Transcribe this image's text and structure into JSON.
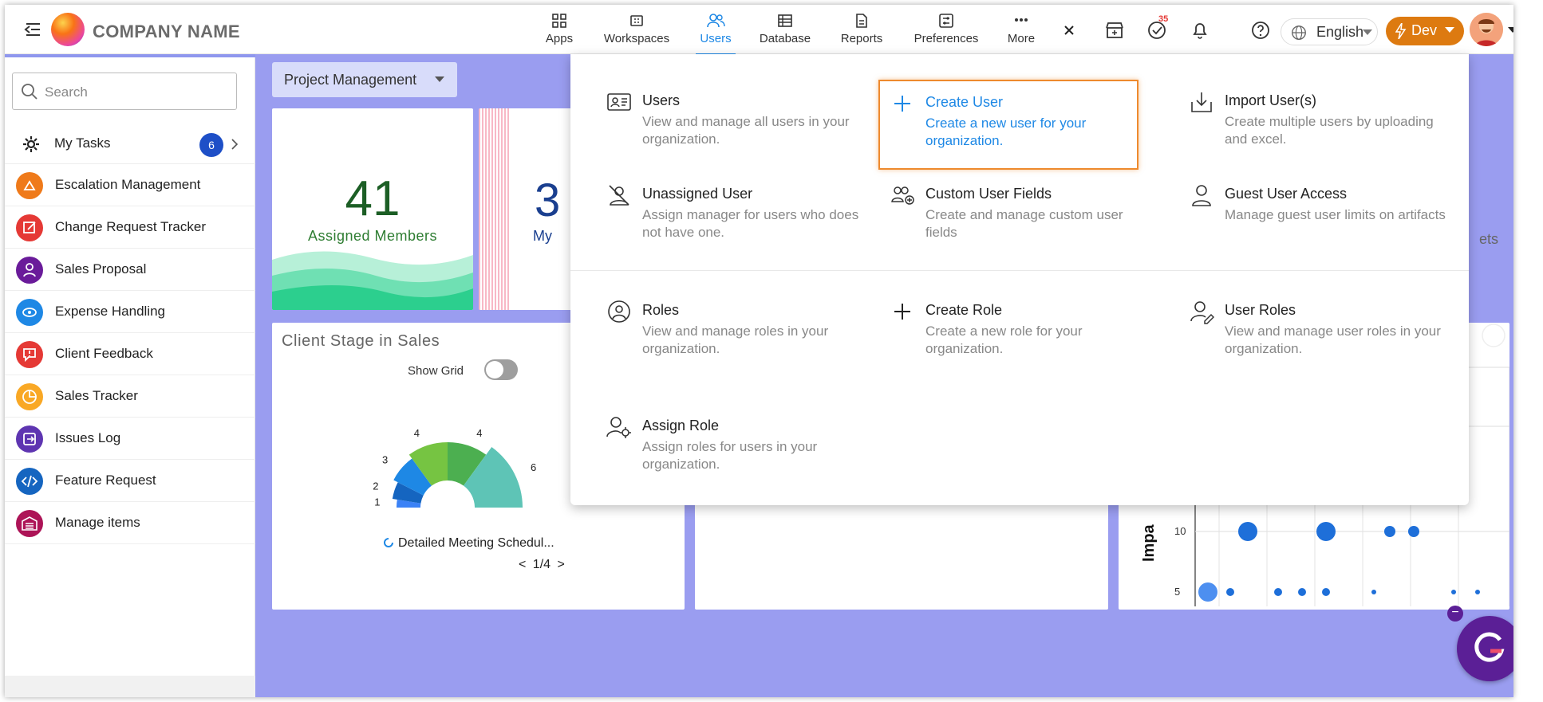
{
  "header": {
    "company_name": "COMPANY NAME",
    "nav": [
      {
        "label": "Apps",
        "icon": "apps-grid-icon"
      },
      {
        "label": "Workspaces",
        "icon": "workspaces-icon"
      },
      {
        "label": "Users",
        "icon": "users-icon",
        "active": true
      },
      {
        "label": "Database",
        "icon": "database-icon"
      },
      {
        "label": "Reports",
        "icon": "reports-icon"
      },
      {
        "label": "Preferences",
        "icon": "preferences-icon"
      },
      {
        "label": "More",
        "icon": "more-dots-icon"
      }
    ],
    "tasks_badge": "35",
    "language": "English",
    "env": "Dev"
  },
  "sidebar": {
    "search_placeholder": "Search",
    "my_tasks": {
      "label": "My Tasks",
      "count": "6"
    },
    "items": [
      {
        "label": "Escalation Management",
        "color": "#ef7a1a"
      },
      {
        "label": "Change Request Tracker",
        "color": "#e53935"
      },
      {
        "label": "Sales Proposal",
        "color": "#6a1b9a"
      },
      {
        "label": "Expense Handling",
        "color": "#1e88e5"
      },
      {
        "label": "Client Feedback",
        "color": "#e53935"
      },
      {
        "label": "Sales Tracker",
        "color": "#f9a825"
      },
      {
        "label": "Issues Log",
        "color": "#5e35b1"
      },
      {
        "label": "Feature Request",
        "color": "#1565c0"
      },
      {
        "label": "Manage items",
        "color": "#ad1457"
      }
    ]
  },
  "main": {
    "workspace_select": "Project Management",
    "kpi": {
      "value": "41",
      "label": "Assigned Members"
    },
    "kpi2": {
      "value": "3",
      "label": "My"
    },
    "kpi3_label_fragment": "ets",
    "client_stage": {
      "title": "Client Stage in Sales",
      "show_grid_label": "Show Grid",
      "legend": "Detailed Meeting Schedul...",
      "pager": "1/4"
    }
  },
  "chart_data": [
    {
      "type": "pie",
      "title": "Client Stage in Sales",
      "categories": [
        "",
        "",
        "",
        "",
        "",
        ""
      ],
      "values": [
        1,
        2,
        3,
        4,
        4,
        6
      ],
      "colors": [
        "#3b82f6",
        "#1565c0",
        "#1e88e5",
        "#76c442",
        "#4caf50",
        "#5ec4b6"
      ]
    },
    {
      "type": "scatter",
      "ylabel": "Impa",
      "y_ticks": [
        5,
        10
      ],
      "points_y10": [
        1,
        1,
        1,
        1
      ],
      "points_y5": [
        1,
        1,
        1,
        1,
        1,
        1,
        1,
        1
      ]
    }
  ],
  "dropdown": {
    "options": [
      {
        "title": "Users",
        "desc": "View and manage all users in your organization.",
        "icon": "user-card-icon"
      },
      {
        "title": "Create User",
        "desc": "Create a new user for your organization.",
        "icon": "plus-icon",
        "highlighted": true
      },
      {
        "title": "Import User(s)",
        "desc": "Create multiple users by uploading and excel.",
        "icon": "import-icon"
      },
      {
        "title": "Unassigned User",
        "desc": "Assign manager for users who does not have one.",
        "icon": "user-slash-icon"
      },
      {
        "title": "Custom User Fields",
        "desc": "Create and manage custom user fields",
        "icon": "custom-fields-icon"
      },
      {
        "title": "Guest User Access",
        "desc": "Manage guest user limits on artifacts",
        "icon": "guest-user-icon"
      },
      {
        "title": "Roles",
        "desc": "View and manage roles in your organization.",
        "icon": "role-icon"
      },
      {
        "title": "Create Role",
        "desc": "Create a new role for your organization.",
        "icon": "plus-icon"
      },
      {
        "title": "User Roles",
        "desc": "View and manage user roles in your organization.",
        "icon": "user-roles-icon"
      },
      {
        "title": "Assign Role",
        "desc": "Assign roles for users in your organization.",
        "icon": "assign-role-icon"
      }
    ]
  }
}
